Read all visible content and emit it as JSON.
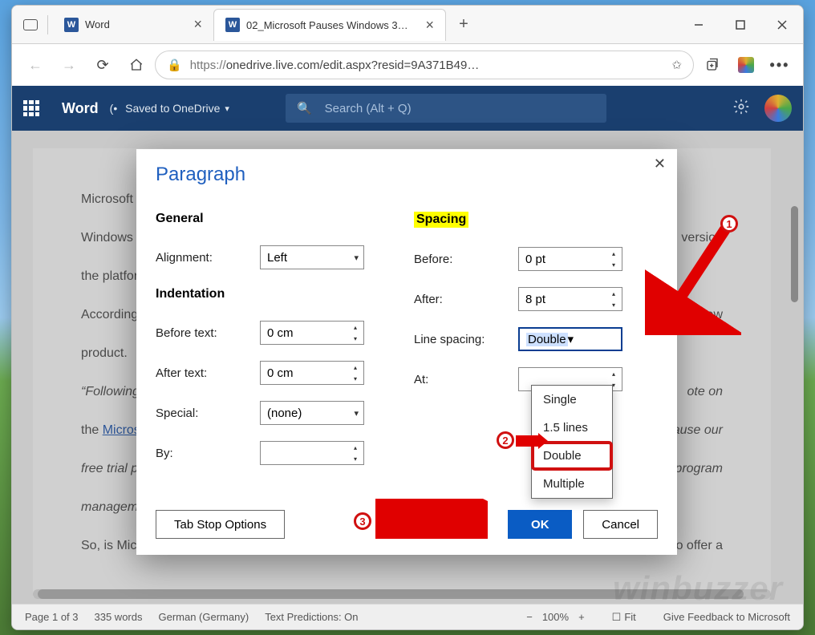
{
  "browser": {
    "tabs": [
      {
        "label": "Word"
      },
      {
        "label": "02_Microsoft Pauses Windows 3…"
      }
    ],
    "url_scheme": "https://",
    "url_rest": "onedrive.live.com/edit.aspx?resid=9A371B49…"
  },
  "ribbon": {
    "app": "Word",
    "status": "Saved to OneDrive",
    "search_placeholder": "Search (Alt + Q)"
  },
  "document": {
    "line1": "Microsoft s                                                                                                                                               urchase",
    "line2a": "Windows 1",
    "line2b": "al version",
    "line3": "the platfor",
    "line4a": "According t",
    "line4b": "new",
    "line5": "product.",
    "line6a": "“Following",
    "line6b": "ote on",
    "line7a": "the ",
    "line7link": "Micros",
    "line7b": "o pause our",
    "line8a": "free trial pr",
    "line8b": "ws 365 program",
    "line9": "manageme",
    "line10a": "So, is Micro",
    "line10b": "eed to offer a"
  },
  "statusbar": {
    "page": "Page 1 of 3",
    "words": "335 words",
    "lang": "German (Germany)",
    "predictions": "Text Predictions: On",
    "zoom": "100%",
    "fit": "Fit",
    "feedback": "Give Feedback to Microsoft"
  },
  "dialog": {
    "title": "Paragraph",
    "general": "General",
    "alignment_label": "Alignment:",
    "alignment_value": "Left",
    "indentation": "Indentation",
    "before_text_label": "Before text:",
    "before_text_value": "0 cm",
    "after_text_label": "After text:",
    "after_text_value": "0 cm",
    "special_label": "Special:",
    "special_value": "(none)",
    "by_label": "By:",
    "by_value": "",
    "spacing": "Spacing",
    "before_label": "Before:",
    "before_value": "0 pt",
    "after_label": "After:",
    "after_value": "8 pt",
    "line_spacing_label": "Line spacing:",
    "line_spacing_value": "Double",
    "at_label": "At:",
    "at_value": "",
    "options": [
      "Single",
      "1.5 lines",
      "Double",
      "Multiple"
    ],
    "tab_stop": "Tab Stop Options",
    "ok": "OK",
    "cancel": "Cancel"
  },
  "badges": {
    "b1": "1",
    "b2": "2",
    "b3": "3"
  }
}
